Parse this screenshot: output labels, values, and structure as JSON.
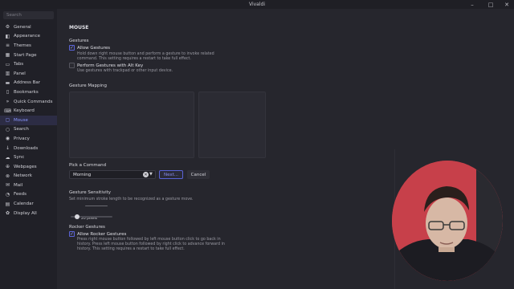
{
  "window": {
    "title": "Vivaldi",
    "controls": [
      "–",
      "□",
      "✕"
    ]
  },
  "sidebar": {
    "search_placeholder": "Search",
    "items": [
      {
        "label": "General",
        "icon": "gear-icon"
      },
      {
        "label": "Appearance",
        "icon": "appearance-icon"
      },
      {
        "label": "Themes",
        "icon": "themes-icon"
      },
      {
        "label": "Start Page",
        "icon": "start-page-icon"
      },
      {
        "label": "Tabs",
        "icon": "tabs-icon"
      },
      {
        "label": "Panel",
        "icon": "panel-icon"
      },
      {
        "label": "Address Bar",
        "icon": "address-bar-icon"
      },
      {
        "label": "Bookmarks",
        "icon": "bookmark-icon"
      },
      {
        "label": "Quick Commands",
        "icon": "quick-commands-icon"
      },
      {
        "label": "Keyboard",
        "icon": "keyboard-icon"
      },
      {
        "label": "Mouse",
        "icon": "mouse-icon"
      },
      {
        "label": "Search",
        "icon": "search-icon"
      },
      {
        "label": "Privacy",
        "icon": "privacy-icon"
      },
      {
        "label": "Downloads",
        "icon": "download-icon"
      },
      {
        "label": "Sync",
        "icon": "sync-icon"
      },
      {
        "label": "Webpages",
        "icon": "webpages-icon"
      },
      {
        "label": "Network",
        "icon": "network-icon"
      },
      {
        "label": "Mail",
        "icon": "mail-icon"
      },
      {
        "label": "Feeds",
        "icon": "feeds-icon"
      },
      {
        "label": "Calendar",
        "icon": "calendar-icon"
      },
      {
        "label": "Display All",
        "icon": "display-all-icon"
      }
    ],
    "active": "Mouse"
  },
  "main": {
    "page_title": "MOUSE",
    "gestures": {
      "heading": "Gestures",
      "allow_label": "Allow Gestures",
      "allow_checked": true,
      "allow_desc_1": "Hold down right mouse button and perform a gesture to invoke related",
      "allow_desc_2": "command. This setting requires a restart to take full effect.",
      "altkey_label": "Perform Gestures with Alt Key",
      "altkey_checked": false,
      "altkey_desc": "Use gestures with trackpad or other input device."
    },
    "mapping": {
      "heading": "Gesture Mapping"
    },
    "command": {
      "heading": "Pick a Command",
      "value": "Morning",
      "next_label": "Next...",
      "cancel_label": "Cancel"
    },
    "sensitivity": {
      "heading": "Gesture Sensitivity",
      "desc": "Set minimum stroke length to be recognized as a gesture move.",
      "value_label": "20 pixels",
      "value_fraction": 0.1
    },
    "rocker": {
      "heading": "Rocker Gestures",
      "allow_label": "Allow Rocker Gestures",
      "allow_checked": true,
      "desc_1": "Press right mouse button followed by left mouse button click to go back in",
      "desc_2": "history. Press left mouse button followed by right click to advance forward in",
      "desc_3": "history. This setting requires a restart to take full effect."
    }
  },
  "colors": {
    "accent": "#8a96ff",
    "sidebar_bg": "#202027",
    "content_bg": "#26262d"
  }
}
